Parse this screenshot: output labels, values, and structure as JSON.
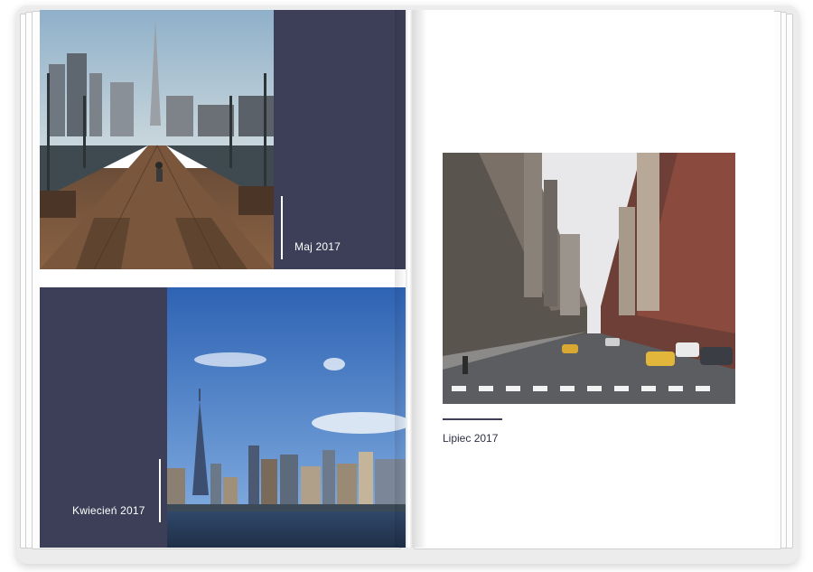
{
  "left_page": {
    "top_caption": "Maj 2017",
    "bottom_caption": "Kwiecień 2017"
  },
  "right_page": {
    "caption": "Lipiec 2017"
  },
  "colors": {
    "panel_navy": "#3c3f57",
    "caption_text": "#ffffff",
    "caption_dark": "#2f3145"
  }
}
